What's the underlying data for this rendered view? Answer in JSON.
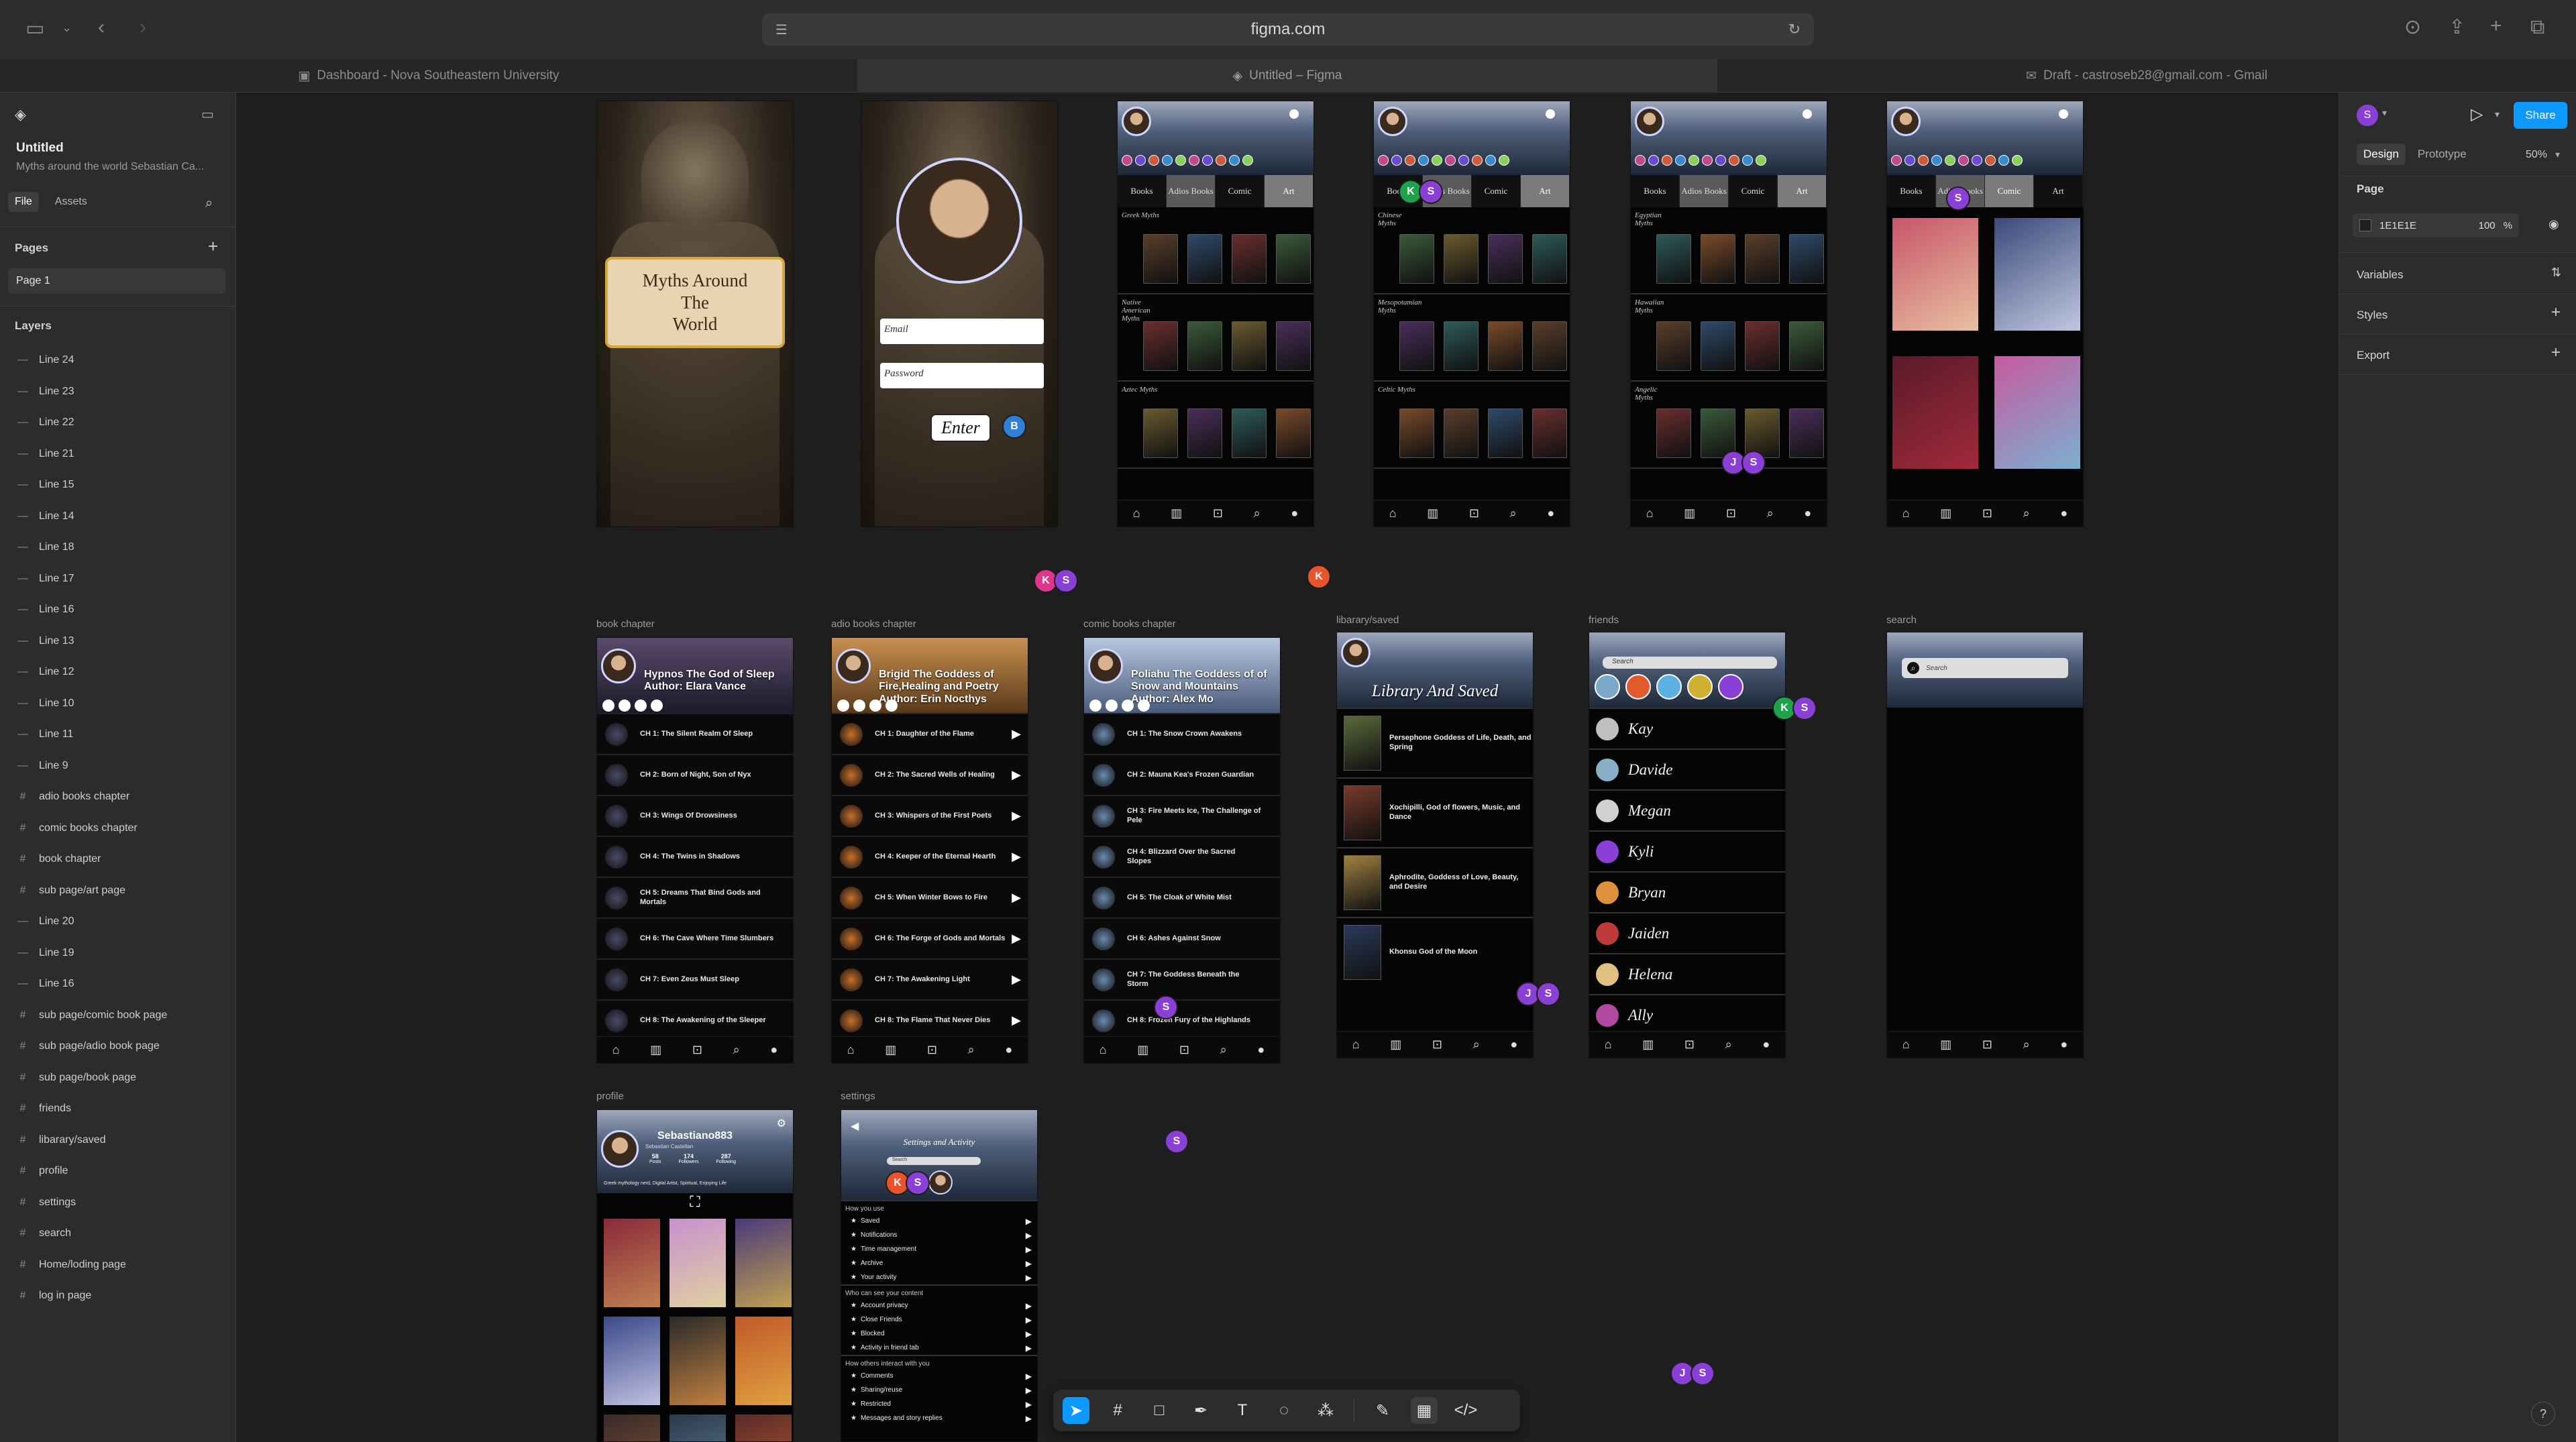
{
  "browser": {
    "url": "figma.com",
    "tabs": [
      {
        "label": "Dashboard - Nova Southeastern University"
      },
      {
        "label": "Untitled – Figma"
      },
      {
        "label": "Draft - castroseb28@gmail.com - Gmail"
      }
    ]
  },
  "left_panel": {
    "file_title": "Untitled",
    "file_subtitle": "Myths around the world Sebastian Ca...",
    "tab_file": "File",
    "tab_assets": "Assets",
    "pages_heading": "Pages",
    "current_page": "Page 1",
    "layers_heading": "Layers",
    "layers": [
      {
        "name": "Line 24",
        "kind": "line"
      },
      {
        "name": "Line 23",
        "kind": "line"
      },
      {
        "name": "Line 22",
        "kind": "line"
      },
      {
        "name": "Line 21",
        "kind": "line"
      },
      {
        "name": "Line 15",
        "kind": "line"
      },
      {
        "name": "Line 14",
        "kind": "line"
      },
      {
        "name": "Line 18",
        "kind": "line"
      },
      {
        "name": "Line 17",
        "kind": "line"
      },
      {
        "name": "Line 16",
        "kind": "line"
      },
      {
        "name": "Line 13",
        "kind": "line"
      },
      {
        "name": "Line 12",
        "kind": "line"
      },
      {
        "name": "Line 10",
        "kind": "line"
      },
      {
        "name": "Line 11",
        "kind": "line"
      },
      {
        "name": "Line 9",
        "kind": "line"
      },
      {
        "name": "adio books chapter",
        "kind": "frame"
      },
      {
        "name": "comic books chapter",
        "kind": "frame"
      },
      {
        "name": "book chapter",
        "kind": "frame"
      },
      {
        "name": "sub page/art page",
        "kind": "frame"
      },
      {
        "name": "Line 20",
        "kind": "line"
      },
      {
        "name": "Line 19",
        "kind": "line"
      },
      {
        "name": "Line 16",
        "kind": "line"
      },
      {
        "name": "sub page/comic book page",
        "kind": "frame"
      },
      {
        "name": "sub page/adio book page",
        "kind": "frame"
      },
      {
        "name": "sub page/book page",
        "kind": "frame"
      },
      {
        "name": "friends",
        "kind": "frame"
      },
      {
        "name": "libarary/saved",
        "kind": "frame"
      },
      {
        "name": "profile",
        "kind": "frame"
      },
      {
        "name": "settings",
        "kind": "frame"
      },
      {
        "name": "search",
        "kind": "frame"
      },
      {
        "name": "Home/loding page",
        "kind": "frame"
      },
      {
        "name": "log in page",
        "kind": "frame"
      }
    ]
  },
  "right_panel": {
    "tab_design": "Design",
    "tab_prototype": "Prototype",
    "zoom": "50%",
    "share_label": "Share",
    "page_heading": "Page",
    "page_color": "1E1E1E",
    "page_opacity": "100",
    "page_opacity_unit": "%",
    "variables_label": "Variables",
    "styles_label": "Styles",
    "export_label": "Export",
    "user_initial": "S"
  },
  "canvas": {
    "home": {
      "title_line1": "Myths Around",
      "title_line2": "The",
      "title_line3": "World"
    },
    "login": {
      "email_placeholder": "Email",
      "password_placeholder": "Password",
      "enter_label": "Enter"
    },
    "tabs_books": "Books",
    "tabs_audio": "Adios Books",
    "tabs_comic": "Comic",
    "tabs_art": "Art",
    "book_page_shelves": [
      "Greek Myths",
      "Native American Myths",
      "Aztec Myths"
    ],
    "audio_page_shelves": [
      "Chinese Myths",
      "Mesopotamian Myths",
      "Celtic Myths"
    ],
    "comic_page_shelves": [
      "Egyptian Myths",
      "Hawaiian Myths",
      "Angelic Myths"
    ],
    "labels": {
      "book_chapter": "book chapter",
      "audio_chapter": "adio books chapter",
      "comic_chapter": "comic books chapter",
      "library": "libarary/saved",
      "friends": "friends",
      "search": "search",
      "profile": "profile",
      "settings": "settings"
    },
    "book_chapter": {
      "title": "Hypnos The God of Sleep Author: Elara Vance",
      "chapters": [
        "CH 1: The Silent Realm Of Sleep",
        "CH 2: Born of Night, Son of Nyx",
        "CH 3: Wings Of Drowsiness",
        "CH 4: The Twins in Shadows",
        "CH 5: Dreams That Bind Gods and Mortals",
        "CH 6: The Cave Where Time Slumbers",
        "CH 7: Even Zeus Must Sleep",
        "CH 8: The Awakening of the Sleeper"
      ]
    },
    "audio_chapter": {
      "title": "Brigid The Goddess of Fire,Healing and Poetry Author: Erin Nocthys",
      "chapters": [
        "CH 1: Daughter of the Flame",
        "CH 2: The Sacred Wells of Healing",
        "CH 3: Whispers of the First Poets",
        "CH 4: Keeper of the Eternal Hearth",
        "CH 5: When Winter Bows to Fire",
        "CH 6: The Forge of Gods and Mortals",
        "CH 7: The Awakening Light",
        "CH 8: The Flame That Never Dies"
      ]
    },
    "comic_chapter": {
      "title": "Poliahu The Goddess of of Snow and Mountains Author: Alex Mo",
      "chapters": [
        "CH 1: The Snow Crown Awakens",
        "CH 2: Mauna Kea's Frozen Guardian",
        "CH 3: Fire Meets Ice, The Challenge of Pele",
        "CH 4: Blizzard Over the Sacred Slopes",
        "CH 5: The Cloak of White Mist",
        "CH 6: Ashes Against Snow",
        "CH 7: The Goddess Beneath the Storm",
        "CH 8: Frozen Fury of the Highlands"
      ]
    },
    "library": {
      "title": "Library And Saved",
      "items": [
        "Persephone Goddess of Life, Death, and Spring",
        "Xochipilli, God of flowers, Music, and Dance",
        "Aphrodite, Goddess of Love, Beauty, and Desire",
        "Khonsu God of the Moon"
      ]
    },
    "friends": {
      "search_placeholder": "Search",
      "names": [
        "Kay",
        "Davide",
        "Megan",
        "Kyli",
        "Bryan",
        "Jaiden",
        "Helena",
        "Ally"
      ]
    },
    "search": {
      "placeholder": "Search"
    },
    "profile": {
      "username": "Sebastiano883",
      "real_name": "Sebastian Castellan",
      "posts_count": "58",
      "posts_label": "Posts",
      "followers_count": "174",
      "followers_label": "Followers",
      "following_count": "287",
      "following_label": "Following",
      "bio": "Greek mythology nerd, Digital Artist, Spiritual, Enjoying Life"
    },
    "settings": {
      "title": "Settings and Activity",
      "search_placeholder": "Search",
      "sec1": "How you use",
      "sec1_items": [
        "Saved",
        "Notifications",
        "Time management",
        "Archive",
        "Your activity"
      ],
      "sec2": "Who can see your content",
      "sec2_items": [
        "Account privacy",
        "Close Friends",
        "Blocked",
        "Activity in friend tab"
      ],
      "sec3": "How others interact with you",
      "sec3_items": [
        "Comments",
        "Sharing/reuse",
        "Restricted",
        "Messages and story replies"
      ]
    },
    "collaborators": [
      {
        "initials": [
          "B"
        ],
        "colors": [
          "#2f7fd6"
        ]
      },
      {
        "initials": [
          "K",
          "S"
        ],
        "colors": [
          "#e0358f",
          "#8a3fd6"
        ]
      },
      {
        "initials": [
          "K"
        ],
        "colors": [
          "#e8542b"
        ]
      },
      {
        "initials": [
          "K",
          "S"
        ],
        "colors": [
          "#1fa34a",
          "#8a3fd6"
        ]
      },
      {
        "initials": [
          "J",
          "S"
        ],
        "colors": [
          "#8a3fd6",
          "#8a3fd6"
        ]
      },
      {
        "initials": [
          "S"
        ],
        "colors": [
          "#8a3fd6"
        ]
      },
      {
        "initials": [
          "K",
          "S"
        ],
        "colors": [
          "#1fa34a",
          "#8a3fd6"
        ]
      },
      {
        "initials": [
          "J",
          "S"
        ],
        "colors": [
          "#8a3fd6",
          "#8a3fd6"
        ]
      },
      {
        "initials": [
          "K",
          "S"
        ],
        "colors": [
          "#e8542b",
          "#8a3fd6"
        ]
      },
      {
        "initials": [
          "S"
        ],
        "colors": [
          "#8a3fd6"
        ]
      },
      {
        "initials": [
          "S"
        ],
        "colors": [
          "#8a3fd6"
        ]
      },
      {
        "initials": [
          "J",
          "S"
        ],
        "colors": [
          "#8a3fd6",
          "#8a3fd6"
        ]
      }
    ]
  },
  "toolbar": {
    "tools": [
      "move-tool",
      "frame-tool",
      "shape-tool",
      "pen-tool",
      "text-tool",
      "comment-tool",
      "actions-tool",
      "draw-mode",
      "design-mode",
      "dev-mode"
    ]
  },
  "help_label": "?"
}
